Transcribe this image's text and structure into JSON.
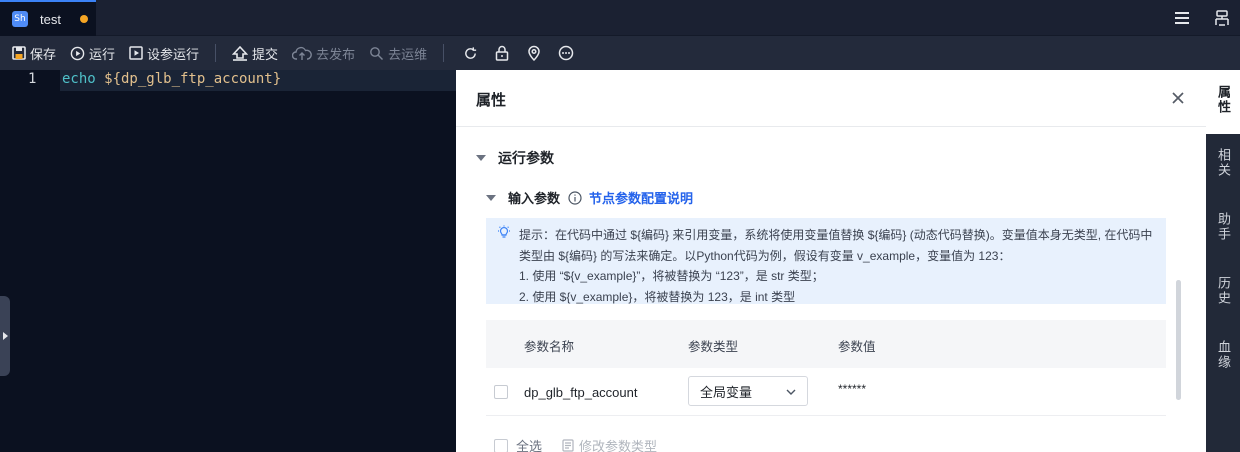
{
  "tabbar": {
    "tab_icon": "Sh",
    "tab_title": "test",
    "unsaved_color": "#f5a524",
    "right_icons": [
      "menu-icon",
      "structure-icon"
    ]
  },
  "toolbar": {
    "save": "保存",
    "run": "运行",
    "run_with_params": "设参运行",
    "submit": "提交",
    "publish": "去发布",
    "ops": "去运维",
    "icons": [
      "refresh-icon",
      "lock-icon",
      "location-icon",
      "more-icon"
    ]
  },
  "editor": {
    "line_number": "1",
    "keyword": "echo",
    "rest": " ${dp_glb_ftp_account}"
  },
  "panel": {
    "title": "属性",
    "section_title": "运行参数",
    "sub_title": "输入参数",
    "help_link": "节点参数配置说明",
    "tip_lines": [
      "提示：在代码中通过 ${编码} 来引用变量，系统将使用变量值替换 ${编码} (动态代码替换)。变量值本身无类型, 在代码中",
      "类型由 ${编码} 的写法来确定。以Python代码为例，假设有变量 v_example，变量值为 123：",
      "1. 使用 “${v_example}”，将被替换为 “123”，是 str 类型；",
      "2. 使用 ${v_example}，将被替换为 123，是 int 类型"
    ],
    "table": {
      "headers": [
        "参数名称",
        "参数类型",
        "参数值"
      ],
      "rows": [
        {
          "name": "dp_glb_ftp_account",
          "type": "全局变量",
          "value": "******"
        }
      ]
    },
    "select_all": "全选",
    "edit_type": "修改参数类型"
  },
  "vtabs": [
    {
      "label": "属性",
      "active": true
    },
    {
      "label": "相关",
      "active": false
    },
    {
      "label": "助手",
      "active": false
    },
    {
      "label": "历史",
      "active": false
    },
    {
      "label": "血缘",
      "active": false
    }
  ],
  "colors": {
    "accent": "#3b82f6",
    "link": "#2563eb",
    "tip_bg": "#e8f1fd"
  }
}
